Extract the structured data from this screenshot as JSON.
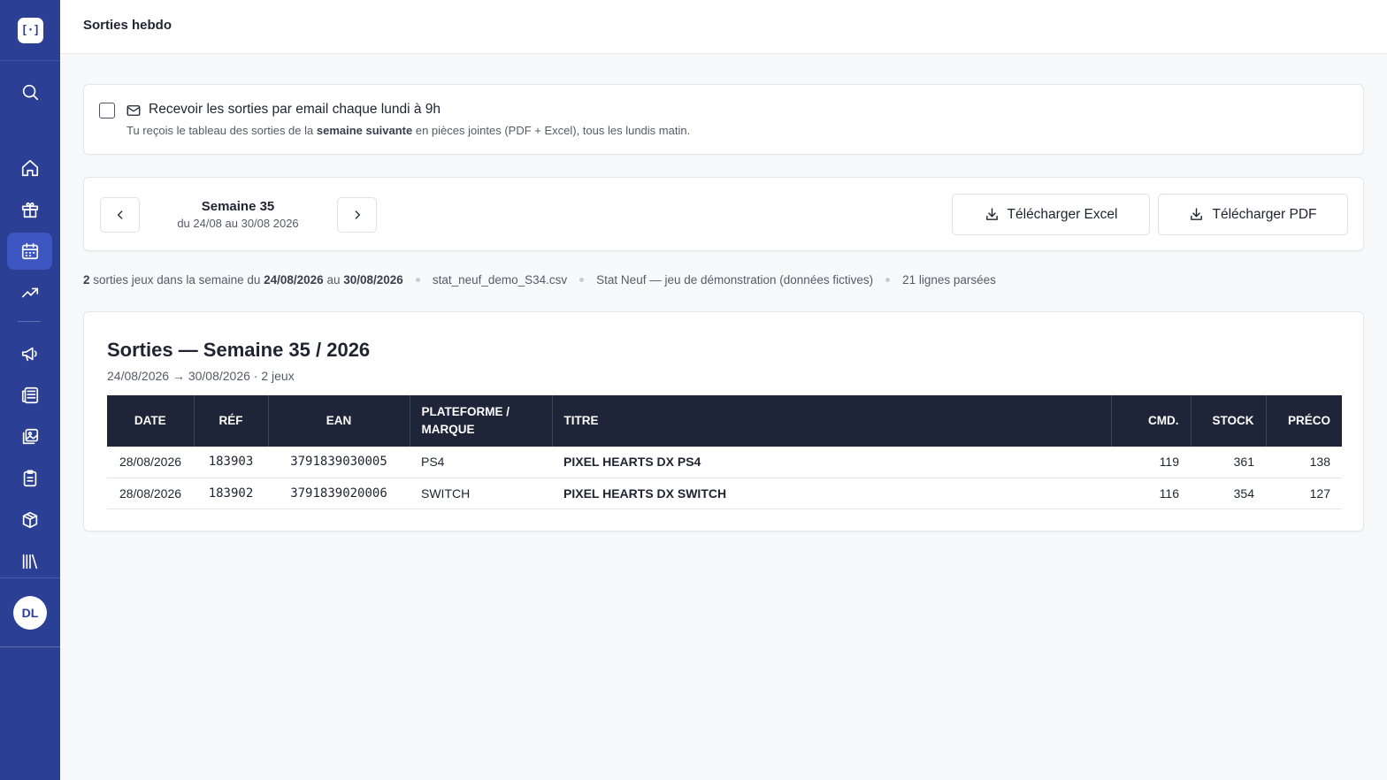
{
  "sidebar": {
    "logo_text": "[·]",
    "icons": [
      "search-icon",
      "home-icon",
      "gift-icon",
      "calendar-icon",
      "trending-icon",
      "megaphone-icon",
      "newspaper-icon",
      "image-icon",
      "clipboard-icon",
      "package-icon",
      "library-icon"
    ],
    "active": "calendar-icon",
    "avatar_initials": "DL"
  },
  "header": {
    "title": "Sorties hebdo"
  },
  "email_subscription": {
    "checked": false,
    "label": "Recevoir les sorties par email chaque lundi à 9h",
    "description_pre": "Tu reçois le tableau des sorties de la ",
    "description_bold": "semaine suivante",
    "description_post": " en pièces jointes (PDF + Excel), tous les lundis matin."
  },
  "week_nav": {
    "week_label": "Semaine 35",
    "range": "du 24/08 au 30/08 2026",
    "download_excel": "Télécharger Excel",
    "download_pdf": "Télécharger PDF"
  },
  "meta": {
    "count": "2",
    "text_a": " sorties jeux dans la semaine du ",
    "start": "24/08/2026",
    "text_b": " au ",
    "end": "30/08/2026",
    "file": "stat_neuf_demo_S34.csv",
    "source": "Stat Neuf — jeu de démonstration (données fictives)",
    "parsed": "21 lignes parsées"
  },
  "table": {
    "title": "Sorties — Semaine 35 / 2026",
    "subtitle": "24/08/2026 → 30/08/2026 · 2 jeux",
    "headers": {
      "date": "Date",
      "ref": "Réf",
      "ean": "EAN",
      "platform_line1": "Plateforme /",
      "platform_line2": "Marque",
      "title": "Titre",
      "cmd": "Cmd.",
      "stock": "Stock",
      "preco": "Préco"
    },
    "rows": [
      {
        "date": "28/08/2026",
        "ref": "183903",
        "ean": "3791839030005",
        "platform": "PS4",
        "title": "PIXEL HEARTS DX PS4",
        "cmd": "119",
        "stock": "361",
        "preco": "138"
      },
      {
        "date": "28/08/2026",
        "ref": "183902",
        "ean": "3791839020006",
        "platform": "SWITCH",
        "title": "PIXEL HEARTS DX SWITCH",
        "cmd": "116",
        "stock": "354",
        "preco": "127"
      }
    ]
  }
}
